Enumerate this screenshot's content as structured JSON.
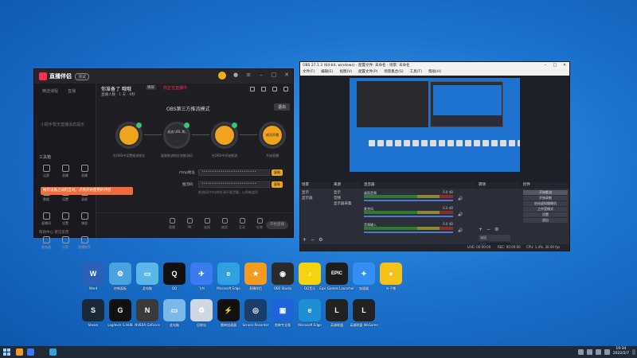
{
  "zhibo": {
    "brand": "直播伴侣",
    "version": "测试",
    "side_tabs": [
      "精选课程",
      "直播"
    ],
    "side_empty": "小助手暂无直播消息提示",
    "tools_title": "工具箱",
    "tools": [
      "运营",
      "直播",
      "直播",
      "数据",
      "设置",
      "录屏",
      "直播间",
      "设置",
      "课程",
      "装饰器",
      "分享",
      "直播推荐"
    ],
    "toast": "推荐设备之间的互动，点我开始使用的伴侣",
    "footer": "帮助中心 意见反馈",
    "room_title": "你准备了 哦哦",
    "room_tag": "横屏",
    "room_red": "你正在直播中",
    "room_sub": "直播人数 · 1 天 · 0秒",
    "obs_mode_title": "OBS第三方推流模式",
    "exit": "退出",
    "steps": [
      {
        "inner": "",
        "caption": "在OBS中设置推流地址"
      },
      {
        "inner": "推流 URL 和推流码",
        "caption": "复制推流地址和推流码"
      },
      {
        "inner": "",
        "caption": "在OBS中开始推流"
      },
      {
        "inner": "成功开播",
        "caption": "开始直播"
      }
    ],
    "rtmp_label": "rtmp地址",
    "rtmp_value": "••••••••••••••••••••••••••",
    "key_label": "推流码",
    "key_value": "••••••••••••••••••••••••••",
    "copy": "复制",
    "field_tip": "推流码/rtmp地址请不要泄露，以防被盗用",
    "bottom": [
      "直播",
      "PK",
      "连线",
      "抽奖",
      "互动",
      "礼物",
      "设置"
    ],
    "golive": "开始直播"
  },
  "obs": {
    "title": "OBS 27.1.3 (64-bit, windows) - 配置文件: 未命名 - 场景: 未命名",
    "menu": [
      "文件(F)",
      "编辑(E)",
      "视图(V)",
      "配置文件(P)",
      "场景集合(S)",
      "工具(T)",
      "帮助(H)"
    ],
    "docks": [
      "场景",
      "来源",
      "混音器",
      "转场",
      "控件"
    ],
    "scenes": [
      "显示",
      "显示器"
    ],
    "sources": [
      "显示",
      "音频",
      "显示器采集"
    ],
    "mixer": [
      {
        "name": "桌面音频",
        "db": "0.0 dB"
      },
      {
        "name": "麦克风",
        "db": "0.0 dB"
      },
      {
        "name": "音频输入",
        "db": "0.0 dB"
      }
    ],
    "transition": "淡出",
    "duration": "300 ms",
    "controls": [
      "开始推流",
      "开始录制",
      "启动虚拟摄像机",
      "工作室模式",
      "设置",
      "退出"
    ],
    "status": [
      "LIVE: 00:00:00",
      "REC: 00:00:00",
      "CPU: 1.4%, 30.00 fps"
    ]
  },
  "desktop": {
    "row1": [
      {
        "label": "Word",
        "icon": "word-icon",
        "color": "#2b5fb8",
        "glyph": "W"
      },
      {
        "label": "控制面板",
        "icon": "control-panel-icon",
        "color": "#4aa3df",
        "glyph": "⚙"
      },
      {
        "label": "此电脑",
        "icon": "computer-icon",
        "color": "#5bb7ea",
        "glyph": "▭"
      },
      {
        "label": "QQ",
        "icon": "qq-icon",
        "color": "#111111",
        "glyph": "Q"
      },
      {
        "label": "飞书",
        "icon": "feishu-icon",
        "color": "#3c7af0",
        "glyph": "✈"
      },
      {
        "label": "Microsoft Edge",
        "icon": "edge-icon",
        "color": "#2fa1e0",
        "glyph": "e"
      },
      {
        "label": "直播伴侣",
        "icon": "zhibo-icon",
        "color": "#f39a1f",
        "glyph": "★"
      },
      {
        "label": "OBS Studio",
        "icon": "obs-icon",
        "color": "#2a2a2a",
        "glyph": "◉"
      },
      {
        "label": "QQ音乐",
        "icon": "qqmusic-icon",
        "color": "#f5d30f",
        "glyph": "♪"
      },
      {
        "label": "Epic Games Launcher",
        "icon": "epic-icon",
        "color": "#1d1d1d",
        "glyph": "EPIC"
      },
      {
        "label": "加速器",
        "icon": "booster-icon",
        "color": "#3390f0",
        "glyph": "✦"
      },
      {
        "label": "叶子猪",
        "icon": "mascot-icon",
        "color": "#f5c21a",
        "glyph": "●"
      }
    ],
    "row2": [
      {
        "label": "Steam",
        "icon": "steam-icon",
        "color": "#1b2838",
        "glyph": "S"
      },
      {
        "label": "Logitech G HUB",
        "icon": "ghub-icon",
        "color": "#111111",
        "glyph": "G"
      },
      {
        "label": "NVIDIA GeForce",
        "icon": "nvidia-icon",
        "color": "#3a3a3a",
        "glyph": "N"
      },
      {
        "label": "此电脑",
        "icon": "laptop-icon",
        "color": "#7ab8e8",
        "glyph": "▭"
      },
      {
        "label": "回收站",
        "icon": "recycle-bin-icon",
        "color": "#cfd8e0",
        "glyph": "♻"
      },
      {
        "label": "雷神加速器",
        "icon": "thunder-icon",
        "color": "#111111",
        "glyph": "⚡"
      },
      {
        "label": "Screen Recorder",
        "icon": "recorder-icon",
        "color": "#1a3d6b",
        "glyph": "◎"
      },
      {
        "label": "剪映专业版",
        "icon": "capcut-icon",
        "color": "#1d64d8",
        "glyph": "▣"
      },
      {
        "label": "Microsoft Edge",
        "icon": "edge2-icon",
        "color": "#1e8fd6",
        "glyph": "e"
      },
      {
        "label": "英雄联盟",
        "icon": "lol-icon",
        "color": "#222222",
        "glyph": "L"
      },
      {
        "label": "英雄联盟 WeGame",
        "icon": "lol2-icon",
        "color": "#222222",
        "glyph": "L"
      }
    ]
  },
  "taskbar": {
    "time": "19:34",
    "date": "2022/2/7",
    "apps": [
      "#f39a1f",
      "#3c7af0",
      "#2a2a2a",
      "#2fa1e0"
    ]
  }
}
